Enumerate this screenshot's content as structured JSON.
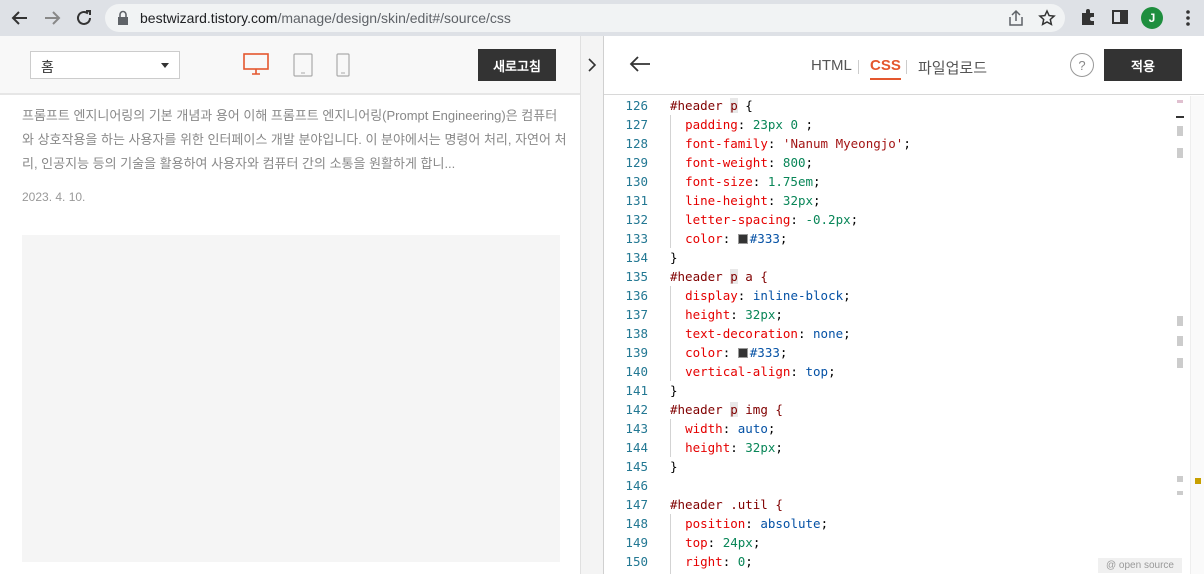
{
  "browser": {
    "url_domain": "bestwizard.tistory.com",
    "url_path": "/manage/design/skin/edit#/source/css",
    "avatar_letter": "J",
    "icons": [
      "back-arrow-icon",
      "forward-arrow-icon",
      "reload-icon",
      "lock-icon",
      "share-icon",
      "bookmark-star-icon",
      "extensions-puzzle-icon",
      "sidebar-icon",
      "kebab-menu-icon"
    ]
  },
  "left_toolbar": {
    "page_select_value": "홈",
    "devices": [
      "desktop-icon",
      "tablet-icon",
      "mobile-icon"
    ],
    "refresh_label": "새로고침"
  },
  "preview": {
    "text": "프롬프트 엔지니어링의 기본 개념과 용어 이해 프롬프트 엔지니어링(Prompt Engineering)은 컴퓨터와 상호작용을 하는 사용자를 위한 인터페이스 개발 분야입니다. 이 분야에서는 명령어 처리, 자연어 처리, 인공지능 등의 기술을 활용하여 사용자와 컴퓨터 간의 소통을 원활하게 합니...",
    "date": "2023. 4. 10."
  },
  "editor_toolbar": {
    "tabs": [
      "HTML",
      "CSS",
      "파일업로드"
    ],
    "active_tab": "CSS",
    "help_label": "?",
    "apply_label": "적용",
    "accent_color": "#e4572e"
  },
  "code": {
    "line_numbers": [
      "126",
      "127",
      "128",
      "129",
      "130",
      "131",
      "132",
      "133",
      "134",
      "135",
      "136",
      "137",
      "138",
      "139",
      "140",
      "141",
      "142",
      "143",
      "144",
      "145",
      "146",
      "147",
      "148",
      "149",
      "150"
    ],
    "l126": {
      "a": "#header ",
      "b": "p",
      "c": " {"
    },
    "l127": {
      "prop": "padding",
      "val": "23px 0",
      "end": " ;"
    },
    "l128": {
      "prop": "font-family",
      "val": "'Nanum Myeongjo'",
      "end": ";"
    },
    "l129": {
      "prop": "font-weight",
      "val": "800",
      "end": ";"
    },
    "l130": {
      "prop": "font-size",
      "val": "1.75em",
      "end": ";"
    },
    "l131": {
      "prop": "line-height",
      "val": "32px",
      "end": ";"
    },
    "l132": {
      "prop": "letter-spacing",
      "val": "-0.2px",
      "end": ";"
    },
    "l133": {
      "prop": "color",
      "val": "#333",
      "end": ";"
    },
    "l134": "}",
    "l135": {
      "a": "#header ",
      "b": "p",
      "c": " a {"
    },
    "l136": {
      "prop": "display",
      "val": "inline-block",
      "end": ";"
    },
    "l137": {
      "prop": "height",
      "val": "32px",
      "end": ";"
    },
    "l138": {
      "prop": "text-decoration",
      "val": "none",
      "end": ";"
    },
    "l139": {
      "prop": "color",
      "val": "#333",
      "end": ";"
    },
    "l140": {
      "prop": "vertical-align",
      "val": "top",
      "end": ";"
    },
    "l141": "}",
    "l142": {
      "a": "#header ",
      "b": "p",
      "c": " img {"
    },
    "l143": {
      "prop": "width",
      "val": "auto",
      "end": ";"
    },
    "l144": {
      "prop": "height",
      "val": "32px",
      "end": ";"
    },
    "l145": "}",
    "l146": "",
    "l147": "#header .util {",
    "l148": {
      "prop": "position",
      "val": "absolute",
      "end": ";"
    },
    "l149": {
      "prop": "top",
      "val": "24px",
      "end": ";"
    },
    "l150": {
      "prop": "right",
      "val": "0",
      "end": ";"
    },
    "swatch_color": "#333333"
  },
  "footer": {
    "open_source_label": "@ open source"
  }
}
